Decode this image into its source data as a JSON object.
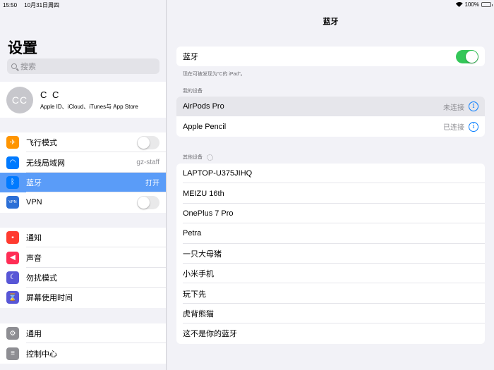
{
  "status_bar": {
    "time": "15:50",
    "date": "10月31日周四",
    "battery": "100%"
  },
  "sidebar": {
    "title": "设置",
    "search_placeholder": "搜索",
    "account": {
      "initials": "CC",
      "name": "C C",
      "subtitle": "Apple ID、iCloud、iTunes与 App Store"
    },
    "group1": [
      {
        "label": "飞行模式",
        "icon": "airplane-icon",
        "color": "#ff9500",
        "toggle": false
      },
      {
        "label": "无线局域网",
        "icon": "wifi-icon",
        "color": "#007aff",
        "value": "gz-staff"
      },
      {
        "label": "蓝牙",
        "icon": "bluetooth-icon",
        "color": "#007aff",
        "value": "打开",
        "selected": true
      },
      {
        "label": "VPN",
        "icon": "vpn-icon",
        "color": "#2c6fd6",
        "icon_text": "VPN",
        "toggle": false
      }
    ],
    "group2": [
      {
        "label": "通知",
        "icon": "notifications-icon",
        "color": "#ff3b30"
      },
      {
        "label": "声音",
        "icon": "sound-icon",
        "color": "#ff2d55"
      },
      {
        "label": "勿扰模式",
        "icon": "moon-icon",
        "color": "#5856d6"
      },
      {
        "label": "屏幕使用时间",
        "icon": "hourglass-icon",
        "color": "#5856d6"
      }
    ],
    "group3": [
      {
        "label": "通用",
        "icon": "gear-icon",
        "color": "#8e8e93"
      },
      {
        "label": "控制中心",
        "icon": "control-center-icon",
        "color": "#8e8e93"
      }
    ]
  },
  "main": {
    "title": "蓝牙",
    "bluetooth_row": {
      "label": "蓝牙",
      "on": true
    },
    "discoverable_caption": "现在可被发现为“C的 iPad”。",
    "my_devices_header": "我的设备",
    "my_devices": [
      {
        "name": "AirPods Pro",
        "status": "未连接",
        "highlighted": true
      },
      {
        "name": "Apple Pencil",
        "status": "已连接"
      }
    ],
    "other_devices_header": "其他设备",
    "other_devices": [
      "LAPTOP-U375JIHQ",
      "MEIZU 16th",
      "OnePlus 7 Pro",
      "Petra",
      "一只大母猪",
      "小米手机",
      "玩下先",
      "虎背熊猫",
      "这不是你的蓝牙"
    ]
  }
}
